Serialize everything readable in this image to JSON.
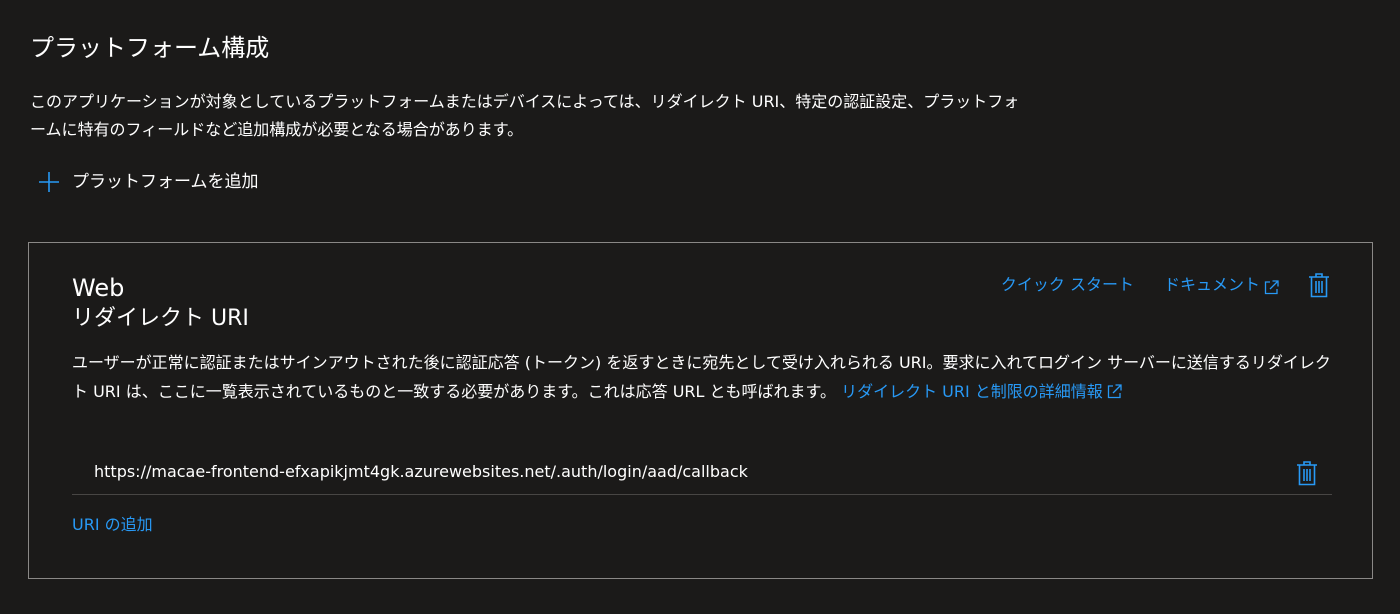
{
  "section": {
    "title": "プラットフォーム構成",
    "description": "このアプリケーションが対象としているプラットフォームまたはデバイスによっては、リダイレクト URI、特定の認証設定、プラットフォームに特有のフィールドなど追加構成が必要となる場合があります。",
    "add_platform_label": "プラットフォームを追加"
  },
  "card": {
    "title": "Web",
    "subtitle": "リダイレクト URI",
    "quick_start_label": "クイック スタート",
    "docs_label": "ドキュメント",
    "description": "ユーザーが正常に認証またはサインアウトされた後に認証応答 (トークン) を返すときに宛先として受け入れられる URI。要求に入れてログイン サーバーに送信するリダイレクト URI は、ここに一覧表示されているものと一致する必要があります。これは応答 URL とも呼ばれます。",
    "learn_more_label": "リダイレクト URI と制限の詳細情報",
    "redirect_uris": [
      "https://macae-frontend-efxapikjmt4gk.azurewebsites.net/.auth/login/aad/callback"
    ],
    "add_uri_label": "URI の追加"
  },
  "icons": {
    "add": "plus-icon",
    "external_link": "external-link-icon",
    "delete": "trash-icon"
  },
  "colors": {
    "background": "#1b1a19",
    "text": "#ffffff",
    "link": "#2899f5",
    "card_border": "#8a8886",
    "divider": "#484644"
  }
}
